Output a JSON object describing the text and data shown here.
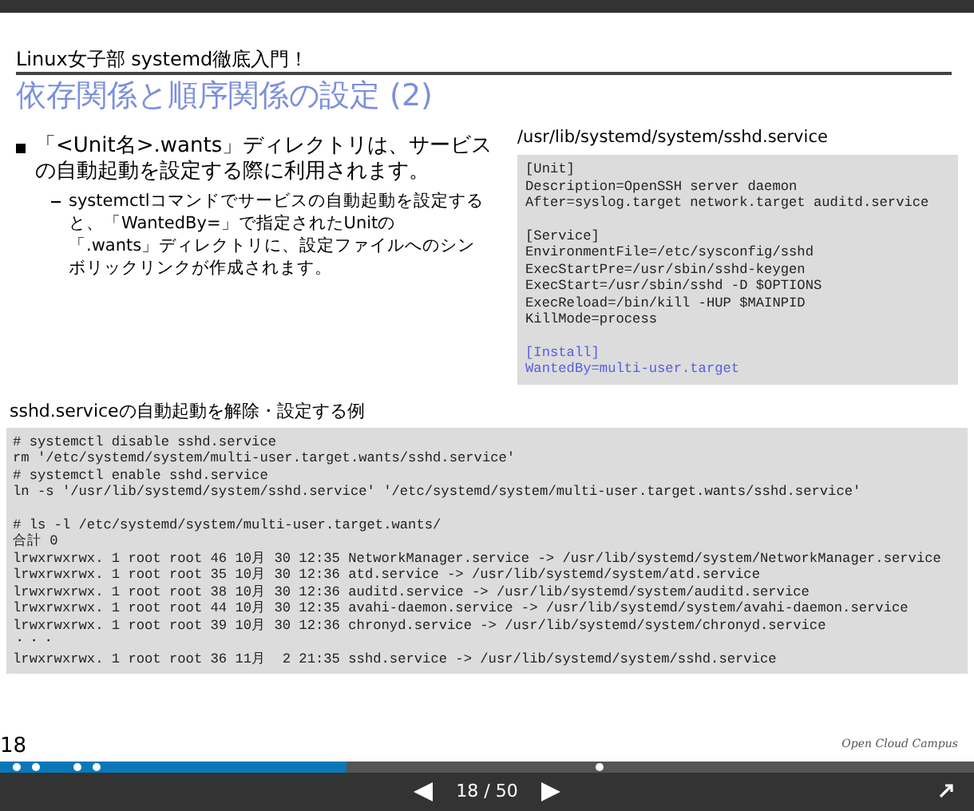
{
  "slide": {
    "header": "Linux女子部 systemd徹底入門！",
    "title": "依存関係と順序関係の設定 (2)",
    "bullets": [
      {
        "text": "「<Unit名>.wants」ディレクトリは、サービスの自動起動を設定する際に利用されます。",
        "children": [
          {
            "text": "systemctlコマンドでサービスの自動起動を設定すると、「WantedBy=」で指定されたUnitの「.wants」ディレクトリに、設定ファイルへのシンボリックリンクが作成されます。"
          }
        ]
      }
    ],
    "file_panel": {
      "path": "/usr/lib/systemd/system/sshd.service",
      "sections": [
        {
          "highlighted": false,
          "lines": [
            "[Unit]",
            "Description=OpenSSH server daemon",
            "After=syslog.target network.target auditd.service"
          ]
        },
        {
          "highlighted": false,
          "lines": [
            "[Service]",
            "EnvironmentFile=/etc/sysconfig/sshd",
            "ExecStartPre=/usr/sbin/sshd-keygen",
            "ExecStart=/usr/sbin/sshd -D $OPTIONS",
            "ExecReload=/bin/kill -HUP $MAINPID",
            "KillMode=process"
          ]
        },
        {
          "highlighted": true,
          "lines": [
            "[Install]",
            "WantedBy=multi-user.target"
          ]
        }
      ]
    },
    "example": {
      "title": "sshd.serviceの自動起動を解除・設定する例",
      "sections": [
        {
          "lines": [
            "# systemctl disable sshd.service",
            "rm '/etc/systemd/system/multi-user.target.wants/sshd.service'",
            "# systemctl enable sshd.service",
            "ln -s '/usr/lib/systemd/system/sshd.service' '/etc/systemd/system/multi-user.target.wants/sshd.service'"
          ]
        },
        {
          "lines": [
            "# ls -l /etc/systemd/system/multi-user.target.wants/",
            "合計 0",
            "lrwxrwxrwx. 1 root root 46 10月 30 12:35 NetworkManager.service -> /usr/lib/systemd/system/NetworkManager.service",
            "lrwxrwxrwx. 1 root root 35 10月 30 12:36 atd.service -> /usr/lib/systemd/system/atd.service",
            "lrwxrwxrwx. 1 root root 38 10月 30 12:36 auditd.service -> /usr/lib/systemd/system/auditd.service",
            "lrwxrwxrwx. 1 root root 44 10月 30 12:35 avahi-daemon.service -> /usr/lib/systemd/system/avahi-daemon.service",
            "lrwxrwxrwx. 1 root root 39 10月 30 12:36 chronyd.service -> /usr/lib/systemd/system/chronyd.service",
            "・・・",
            "lrwxrwxrwx. 1 root root 36 11月  2 21:35 sshd.service -> /usr/lib/systemd/system/sshd.service"
          ]
        }
      ]
    },
    "page_number": "18",
    "brand": "Open Cloud Campus"
  },
  "player": {
    "progress": {
      "level": 0.356
    },
    "page_counter": "18 / 50"
  }
}
